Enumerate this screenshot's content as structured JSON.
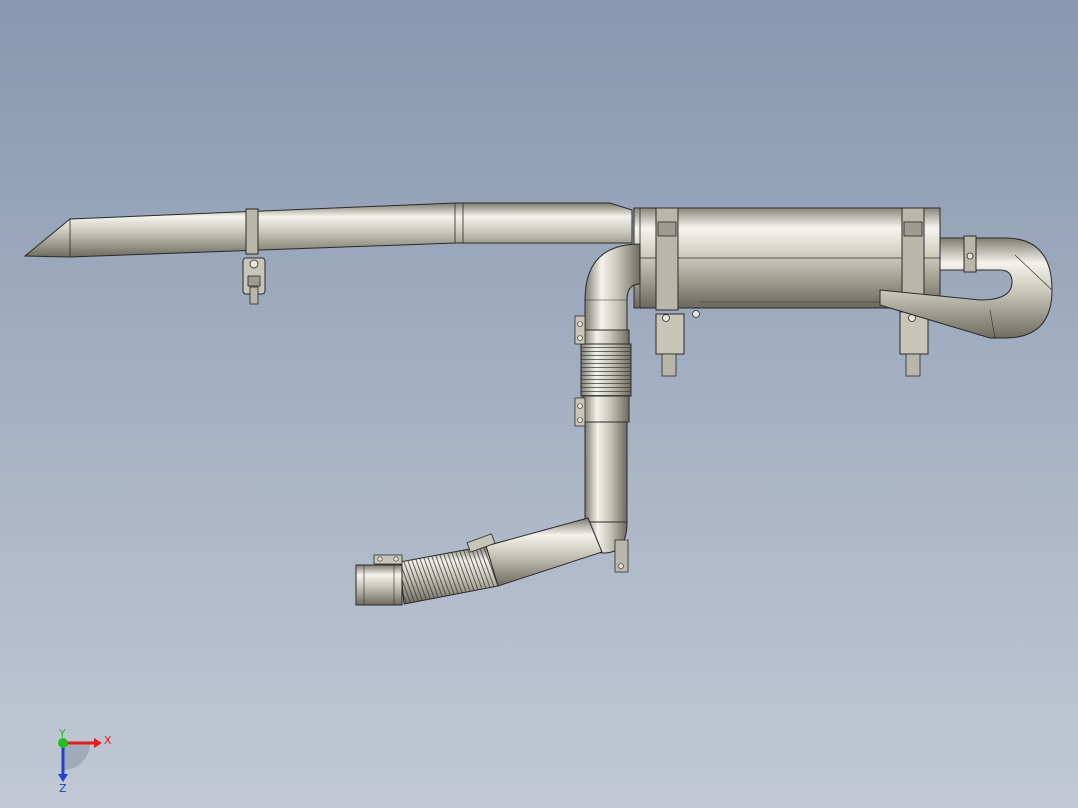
{
  "viewport": {
    "background_top": "#8898b0",
    "background_bottom": "#c2c9d5",
    "part_fill": "#c4c2b4",
    "part_highlight": "#f2f1ea",
    "part_shadow": "#7a786c",
    "edge_color": "#2a2a2a"
  },
  "triad": {
    "x_label": "X",
    "y_label": "Y",
    "z_label": "Z",
    "x_color": "#e02020",
    "y_color": "#20c020",
    "z_color": "#2040d0"
  }
}
